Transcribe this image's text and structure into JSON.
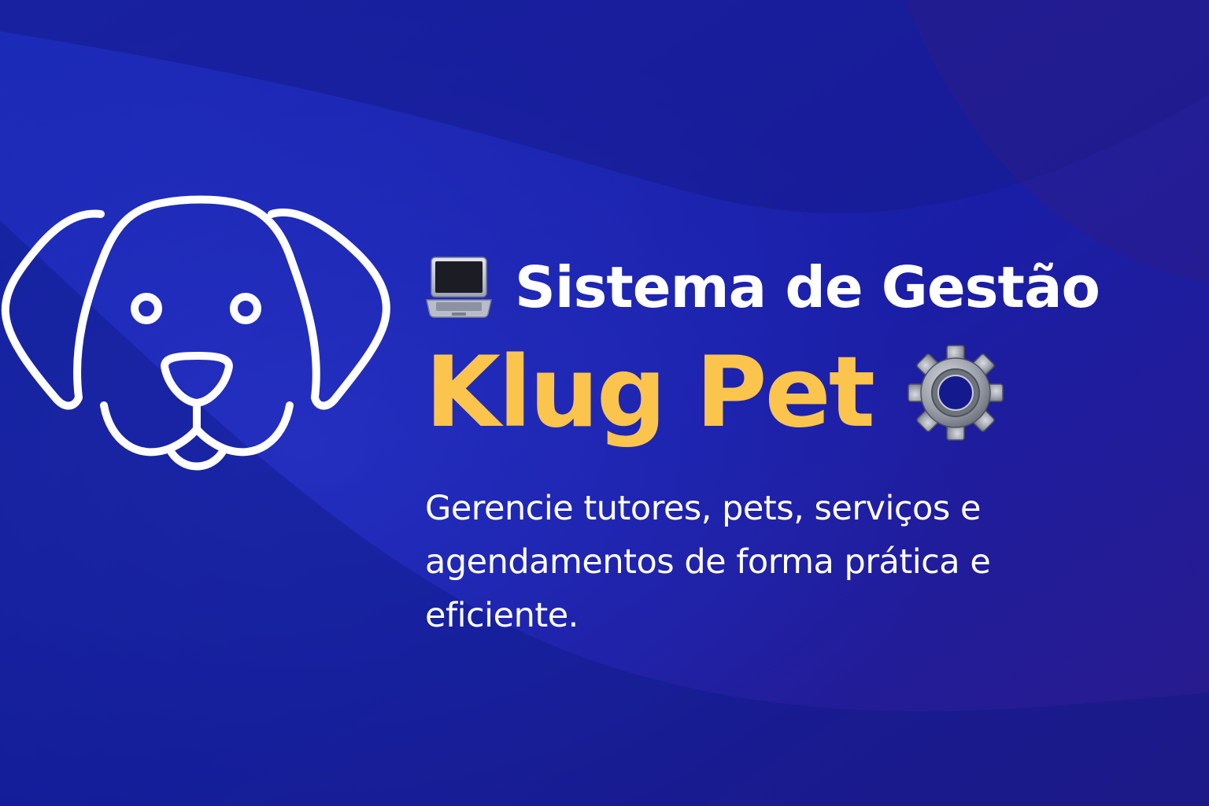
{
  "hero": {
    "headline": "Sistema de Gestão",
    "brand_name": "Klug Pet",
    "tagline": "Gerencie tutores, pets, serviços e agendamentos de forma prática e eficiente."
  },
  "icons": {
    "logo": "dog-face-outline",
    "headline": "laptop-icon",
    "brand": "gear-icon"
  },
  "colors": {
    "background_start": "#1b27b8",
    "background_end": "#2a1a88",
    "headline": "#ffffff",
    "brand": "#fbc44d",
    "tagline": "#ffffff"
  }
}
